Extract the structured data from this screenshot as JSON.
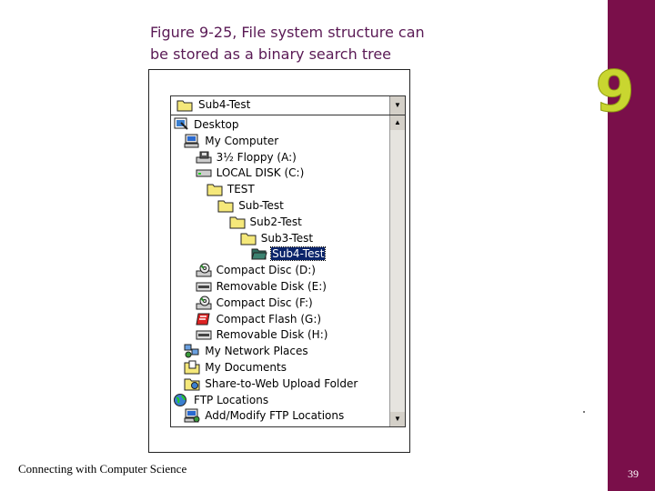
{
  "slide": {
    "title_line1": "Figure 9-25, File system structure can",
    "title_line2": "be stored as a binary search tree",
    "footer": "Connecting with Computer Science",
    "page_number": "39",
    "chapter_number": "9",
    "accent_color": "#7a0f4a",
    "chapter_color": "#c9d630"
  },
  "explorer": {
    "address_value": "Sub4-Test",
    "tree": [
      {
        "label": "Desktop",
        "icon": "desktop-icon",
        "level": 0
      },
      {
        "label": "My Computer",
        "icon": "computer-icon",
        "level": 1
      },
      {
        "label": "3½ Floppy (A:)",
        "icon": "floppy-icon",
        "level": 2
      },
      {
        "label": "LOCAL DISK (C:)",
        "icon": "hard-disk-icon",
        "level": 2
      },
      {
        "label": "TEST",
        "icon": "folder-icon",
        "level": 3
      },
      {
        "label": "Sub-Test",
        "icon": "folder-icon",
        "level": 4
      },
      {
        "label": "Sub2-Test",
        "icon": "folder-icon",
        "level": 5
      },
      {
        "label": "Sub3-Test",
        "icon": "folder-icon",
        "level": 6
      },
      {
        "label": "Sub4-Test",
        "icon": "open-folder-icon",
        "level": 7,
        "selected": true
      },
      {
        "label": "Compact Disc (D:)",
        "icon": "cd-drive-icon",
        "level": 2
      },
      {
        "label": "Removable Disk (E:)",
        "icon": "removable-disk-icon",
        "level": 2
      },
      {
        "label": "Compact Disc (F:)",
        "icon": "cd-drive-icon",
        "level": 2
      },
      {
        "label": "Compact Flash (G:)",
        "icon": "compact-flash-icon",
        "level": 2
      },
      {
        "label": "Removable Disk (H:)",
        "icon": "removable-disk-icon",
        "level": 2
      },
      {
        "label": "My Network Places",
        "icon": "network-icon",
        "level": 1
      },
      {
        "label": "My Documents",
        "icon": "documents-icon",
        "level": 1
      },
      {
        "label": "Share-to-Web Upload Folder",
        "icon": "share-folder-icon",
        "level": 1
      },
      {
        "label": "FTP Locations",
        "icon": "globe-icon",
        "level": 0
      },
      {
        "label": "Add/Modify FTP Locations",
        "icon": "ftp-add-icon",
        "level": 1
      }
    ]
  }
}
